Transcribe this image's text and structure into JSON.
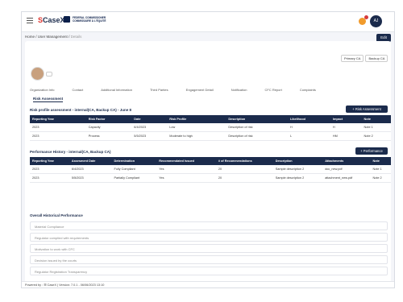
{
  "app": {
    "logo_text": "CaseX",
    "logo_prefix": "S",
    "partner": "FEDERAL COMMISSIONER\nCOMMISSAIRE À L'ÉQUITÉ"
  },
  "header": {
    "avatar_initials": "AJ"
  },
  "breadcrumb": {
    "home": "Home",
    "section": "User Management",
    "page": "Details"
  },
  "edit_label": "Edit",
  "top_tabs": [
    "Primary CA",
    "Backup CA"
  ],
  "nav_tabs": [
    "Organization Info",
    "Contact",
    "Additional Information",
    "Third Parties",
    "Engagement Detail",
    "Notification",
    "CFC Report",
    "Complaints"
  ],
  "subtab": "Risk Assessment",
  "risk": {
    "title": "Risk profile assessment - internal(CA, Backup CA) - June 8",
    "add_label": "+ Risk Assessment",
    "headers": [
      "Reporting Year",
      "Risk Factor",
      "Date",
      "Risk Profile",
      "Description",
      "Likelihood",
      "Impact",
      "Note"
    ],
    "rows": [
      [
        "2023",
        "Capacity",
        "6/4/2023",
        "Low",
        "Description of risk",
        "H",
        "H",
        "Note 1"
      ],
      [
        "2023",
        "Process",
        "5/5/2023",
        "Moderate to high",
        "Description of risk",
        "L",
        "HM",
        "Note 2"
      ]
    ]
  },
  "performance": {
    "title": "Performance History - internal(CA, Backup CA)",
    "add_label": "+ Performance",
    "headers": [
      "Reporting Year",
      "Assesment Date",
      "Determination",
      "Recommendated Issued",
      "# of Recommendations",
      "Description",
      "Attachments",
      "Note"
    ],
    "rows": [
      [
        "2023",
        "6/4/2023",
        "Fully Compliant",
        "Yes",
        "20",
        "Sample description 2",
        "doc_new.pdf",
        "Note 1"
      ],
      [
        "2023",
        "5/5/2023",
        "Partially Compliant",
        "Yes",
        "20",
        "Sample description 2",
        "attachment_new.pdf",
        "Note 2"
      ]
    ]
  },
  "ohp": {
    "title": "Overall Historical Performance",
    "fields": [
      "Material Compliance",
      "Regulator complied with requirements",
      "Motivation to work with CFC",
      "Decision issued by the courts",
      "Regulator Registration Transparency"
    ]
  },
  "footer": "Powered by : ☰ CaseX  |  Version: 7.0.1 - 06/06/2023 13:10"
}
